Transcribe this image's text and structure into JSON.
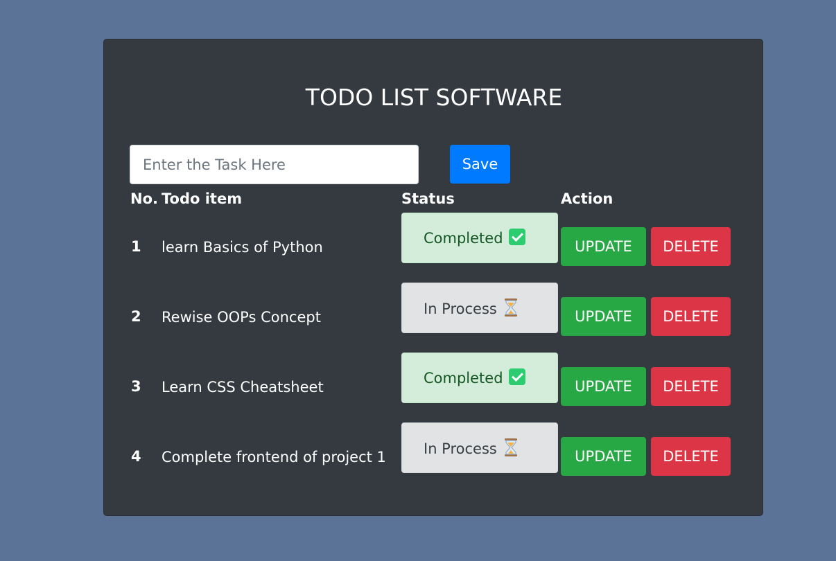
{
  "app": {
    "title": "TODO LIST SOFTWARE"
  },
  "form": {
    "input_placeholder": "Enter the Task Here",
    "save_label": "Save"
  },
  "table": {
    "headers": {
      "no": "No.",
      "item": "Todo item",
      "status": "Status",
      "action": "Action"
    },
    "rows": [
      {
        "no": "1",
        "item": "learn Basics of Python",
        "status": "Completed",
        "status_icon": "check-mark-icon"
      },
      {
        "no": "2",
        "item": "Rewise OOPs Concept",
        "status": "In Process",
        "status_icon": "hourglass-icon"
      },
      {
        "no": "3",
        "item": "Learn CSS Cheatsheet",
        "status": "Completed",
        "status_icon": "check-mark-icon"
      },
      {
        "no": "4",
        "item": "Complete frontend of project 1",
        "status": "In Process",
        "status_icon": "hourglass-icon"
      }
    ],
    "update_label": "UPDATE",
    "delete_label": "DELETE"
  },
  "colors": {
    "background": "#5a7397",
    "card": "#343a40",
    "save": "#007bff",
    "update": "#28a745",
    "delete": "#dc3545",
    "completed_bg": "#d4edda",
    "in_process_bg": "#e2e3e5"
  }
}
